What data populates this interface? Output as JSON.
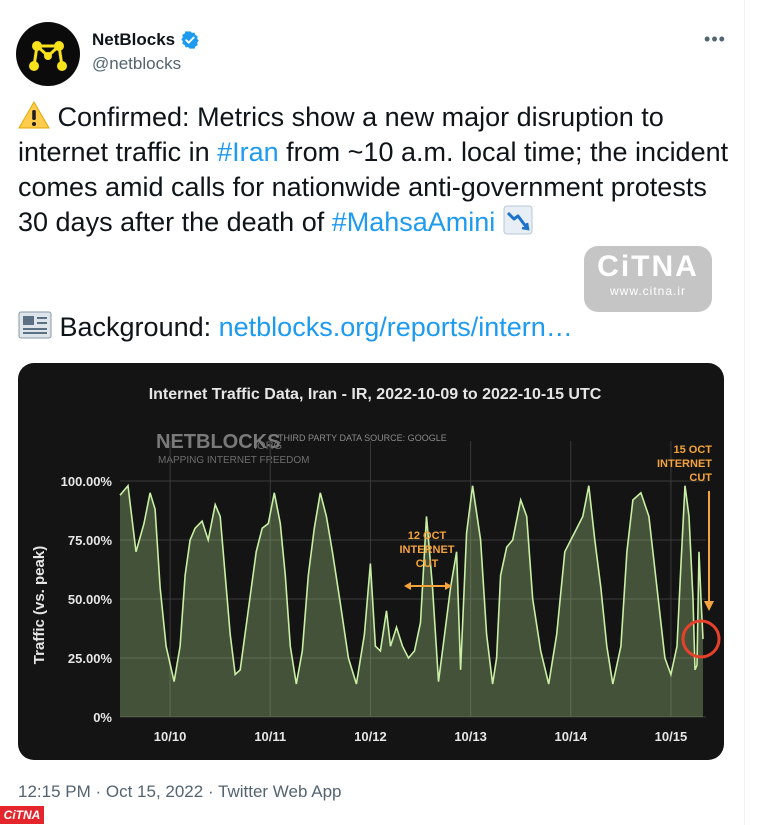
{
  "tweet": {
    "display_name": "NetBlocks",
    "handle": "@netblocks",
    "text_parts": [
      "Confirmed: Metrics show a new major disruption to internet traffic in ",
      "#Iran",
      " from ~10 a.m. local time; the incident comes amid calls for nationwide anti-government protests 30 days after the death of ",
      "#MahsaAmini"
    ],
    "background_label": "Background: ",
    "background_link": "netblocks.org/reports/intern…",
    "timestamp": "12:15 PM · Oct 15, 2022 · Twitter Web App"
  },
  "watermark": {
    "logo": "CiTNA",
    "url": "www.citna.ir",
    "corner": "CiTNA"
  },
  "icons": [
    "netblocks-logo-icon",
    "verified-badge-icon",
    "more-icon",
    "warning-icon",
    "chart-decreasing-icon",
    "newspaper-icon"
  ],
  "colors": {
    "link": "#1d9bf0",
    "chart_bg": "#141414",
    "series": "#c8efa4",
    "annotation": "#f5a33b",
    "marker": "#e8412b"
  },
  "chart_data": {
    "type": "area",
    "title": "Internet Traffic Data, Iran - IR, 2022-10-09 to 2022-10-15 UTC",
    "brand": "NETBLOCKS",
    "brand_suffix": ".ORG",
    "brand_sub": "MAPPING INTERNET FREEDOM",
    "source": "THIRD PARTY DATA SOURCE: GOOGLE",
    "ylabel": "Traffic (vs. peak)",
    "ylim": [
      0,
      100
    ],
    "y_ticks": [
      "0%",
      "25.00%",
      "50.00%",
      "75.00%",
      "100.00%"
    ],
    "x_ticks": [
      "10/10",
      "10/11",
      "10/12",
      "10/13",
      "10/14",
      "10/15"
    ],
    "grid": true,
    "annotations": [
      {
        "text_lines": [
          "12 OCT",
          "INTERNET",
          "CUT"
        ]
      },
      {
        "text_lines": [
          "15 OCT",
          "INTERNET",
          "CUT"
        ]
      }
    ],
    "x": [
      9.5,
      9.58,
      9.66,
      9.74,
      9.8,
      9.85,
      9.9,
      9.96,
      10.04,
      10.1,
      10.15,
      10.2,
      10.25,
      10.32,
      10.38,
      10.45,
      10.5,
      10.56,
      10.6,
      10.65,
      10.7,
      10.78,
      10.86,
      10.92,
      10.98,
      11.04,
      11.1,
      11.15,
      11.2,
      11.26,
      11.32,
      11.38,
      11.44,
      11.5,
      11.56,
      11.62,
      11.7,
      11.78,
      11.86,
      11.94,
      12.0,
      12.05,
      12.1,
      12.16,
      12.2,
      12.26,
      12.32,
      12.38,
      12.44,
      12.5,
      12.56,
      12.62,
      12.68,
      12.74,
      12.8,
      12.86,
      12.9,
      12.96,
      13.02,
      13.1,
      13.16,
      13.22,
      13.26,
      13.3,
      13.36,
      13.42,
      13.5,
      13.56,
      13.62,
      13.7,
      13.78,
      13.86,
      13.94,
      14.0,
      14.06,
      14.12,
      14.18,
      14.24,
      14.3,
      14.36,
      14.42,
      14.5,
      14.56,
      14.62,
      14.7,
      14.78,
      14.86,
      14.94,
      15.0,
      15.06,
      15.1,
      15.14,
      15.18,
      15.22,
      15.24,
      15.26,
      15.28,
      15.3,
      15.32
    ],
    "values": [
      94,
      98,
      70,
      82,
      95,
      88,
      55,
      30,
      15,
      30,
      60,
      75,
      80,
      83,
      75,
      90,
      85,
      55,
      35,
      18,
      20,
      45,
      70,
      80,
      82,
      95,
      82,
      60,
      30,
      14,
      28,
      60,
      80,
      95,
      85,
      70,
      48,
      25,
      14,
      35,
      65,
      30,
      28,
      45,
      30,
      38,
      30,
      25,
      28,
      40,
      85,
      55,
      15,
      35,
      55,
      70,
      20,
      78,
      98,
      75,
      35,
      14,
      25,
      60,
      72,
      75,
      92,
      85,
      50,
      28,
      14,
      35,
      70,
      75,
      80,
      85,
      98,
      75,
      55,
      30,
      14,
      30,
      70,
      92,
      95,
      85,
      55,
      25,
      18,
      30,
      65,
      98,
      85,
      50,
      20,
      22,
      70,
      50,
      33
    ]
  }
}
